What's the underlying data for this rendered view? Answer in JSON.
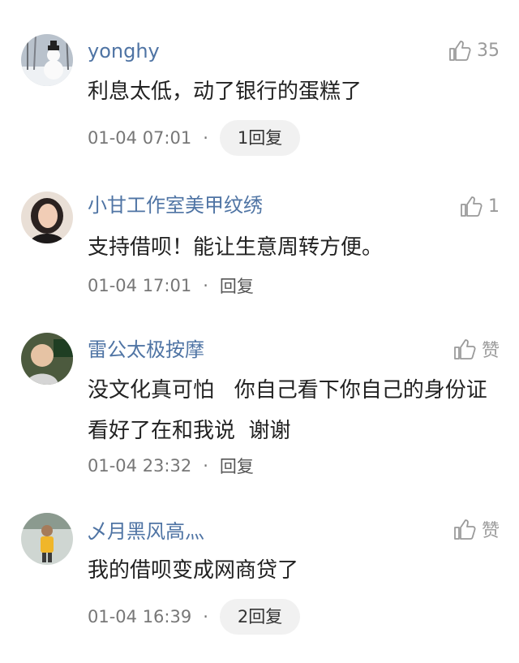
{
  "comments": [
    {
      "user": "yonghy",
      "likes": "35",
      "text": "利息太低，动了银行的蛋糕了",
      "time": "01-04 07:01",
      "reply": "1回复",
      "reply_style": "pill",
      "avatar_icon": "snowman-avatar"
    },
    {
      "user": "小甘工作室美甲纹绣",
      "likes": "1",
      "text": "支持借呗！能让生意周转方便。",
      "time": "01-04 17:01",
      "reply": "回复",
      "reply_style": "plain",
      "avatar_icon": "woman-portrait-avatar"
    },
    {
      "user": "雷公太极按摩",
      "likes": "赞",
      "text": "没文化真可怕   你自己看下你自己的身份证   看好了在和我说  谢谢",
      "time": "01-04 23:32",
      "reply": "回复",
      "reply_style": "plain",
      "avatar_icon": "man-portrait-avatar"
    },
    {
      "user": "乄月黑风高灬",
      "likes": "赞",
      "text": "我的借呗变成网商贷了",
      "time": "01-04 16:39",
      "reply": "2回复",
      "reply_style": "pill",
      "avatar_icon": "man-yellow-shirt-avatar"
    }
  ],
  "dot_separator": "·",
  "colors": {
    "username": "#4f74a4",
    "text": "#222222",
    "meta": "#777777",
    "like": "#9a9a9a",
    "pill_bg": "#f1f1f1"
  }
}
